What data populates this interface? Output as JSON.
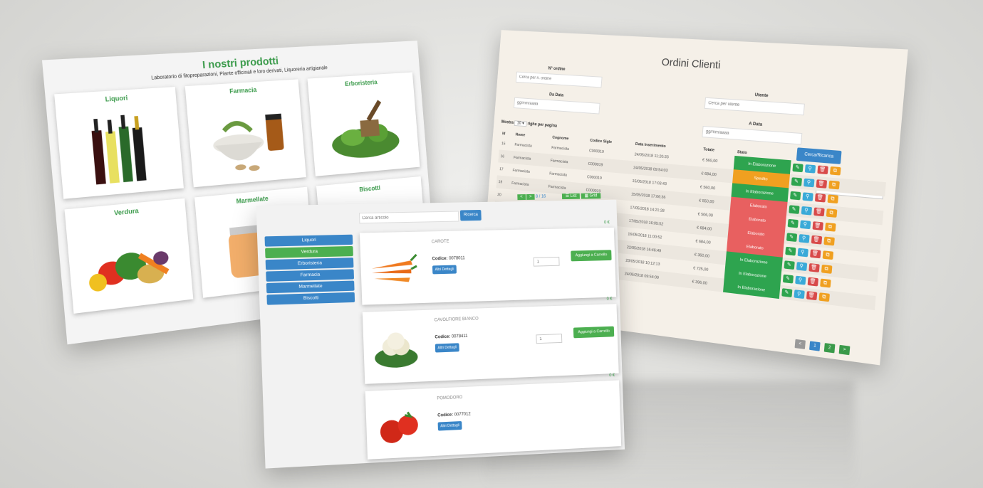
{
  "products": {
    "title": "I nostri prodotti",
    "subtitle": "Laboratorio di fitopreparazioni, Piante officinali e loro derivati, Liquoreria artigianale",
    "categories": [
      {
        "label": "Liquori"
      },
      {
        "label": "Farmacia"
      },
      {
        "label": "Erboristeria"
      },
      {
        "label": "Verdura"
      },
      {
        "label": "Marmellate"
      },
      {
        "label": "Biscotti"
      }
    ]
  },
  "orders": {
    "title": "Ordini Clienti",
    "filters": {
      "order_label": "N° ordine",
      "order_placeholder": "Cerca per n. ordine",
      "user_label": "Utente",
      "user_placeholder": "Cerca per utente",
      "from_label": "Da Data",
      "from_placeholder": "gg/mm/aaaa",
      "to_label": "A Data",
      "to_placeholder": "gg/mm/aaaa",
      "search_button": "Cerca/Ricarica"
    },
    "show_prefix": "Mostra",
    "show_value": "10",
    "show_suffix": "righe per pagina",
    "search_label": "Ricerca",
    "columns": [
      "Id",
      "Nome",
      "Cognome",
      "Codice Sigle",
      "Data Inserimento",
      "Totale",
      "Stato"
    ],
    "rows": [
      {
        "id": "15",
        "nome": "Farmacista",
        "cognome": "Farmacista",
        "codice": "C000019",
        "data": "24/05/2018 11:20:33",
        "totale": "€ 560,00",
        "stato": "In Elaborazione",
        "color": "#2ea44f"
      },
      {
        "id": "16",
        "nome": "Farmacista",
        "cognome": "Farmacista",
        "codice": "C000019",
        "data": "24/05/2018 09:54:03",
        "totale": "€ 684,00",
        "stato": "Spedito",
        "color": "#f0a020"
      },
      {
        "id": "17",
        "nome": "Farmacista",
        "cognome": "Farmacista",
        "codice": "C000019",
        "data": "15/05/2018 17:03:43",
        "totale": "€ 560,00",
        "stato": "In Elaborazione",
        "color": "#2ea44f"
      },
      {
        "id": "19",
        "nome": "Farmacista",
        "cognome": "Farmacista",
        "codice": "C000019",
        "data": "15/05/2018 17:06:36",
        "totale": "€ 550,00",
        "stato": "Elaborato",
        "color": "#e86060"
      },
      {
        "id": "20",
        "nome": "",
        "cognome": "",
        "codice": "",
        "data": "17/05/2018 14:21:28",
        "totale": "€ 506,00",
        "stato": "Elaborato",
        "color": "#e86060"
      },
      {
        "id": "",
        "nome": "",
        "cognome": "",
        "codice": "",
        "data": "17/05/2018 16:05:52",
        "totale": "€ 684,00",
        "stato": "Elaborato",
        "color": "#e86060"
      },
      {
        "id": "",
        "nome": "",
        "cognome": "",
        "codice": "",
        "data": "16/05/2018 11:00:52",
        "totale": "€ 684,00",
        "stato": "Elaborato",
        "color": "#e86060"
      },
      {
        "id": "",
        "nome": "",
        "cognome": "",
        "codice": "",
        "data": "22/05/2018 16:46:49",
        "totale": "€ 360,00",
        "stato": "In Elaborazione",
        "color": "#2ea44f"
      },
      {
        "id": "",
        "nome": "",
        "cognome": "",
        "codice": "",
        "data": "23/05/2018 10:12:13",
        "totale": "€ 725,00",
        "stato": "In Elaborazione",
        "color": "#2ea44f"
      },
      {
        "id": "",
        "nome": "",
        "cognome": "",
        "codice": "",
        "data": "24/05/2018 09:54:09",
        "totale": "€ 396,00",
        "stato": "In Elaborazione",
        "color": "#2ea44f"
      }
    ],
    "pagination": {
      "prev": "<",
      "pages": [
        "1",
        "2"
      ],
      "next": ">"
    }
  },
  "catalog": {
    "search_placeholder": "Cerca articolo",
    "search_button": "Ricerca",
    "pager_text": "8 / 16",
    "pager_prev": "<",
    "pager_next": ">",
    "list_button": "List",
    "grid_button": "Grid",
    "sidebar": [
      "Liquori",
      "Verdura",
      "Erboristeria",
      "Farmacia",
      "Marmellate",
      "Biscotti"
    ],
    "items": [
      {
        "name": "CAROTE",
        "code_label": "Codice:",
        "code": "0078011",
        "details": "Altri Dettagli",
        "qty": "1",
        "add": "Aggiungi a Carrello",
        "price": "0 €"
      },
      {
        "name": "CAVOLFIORE BIANCO",
        "code_label": "Codice:",
        "code": "0078411",
        "details": "Altri Dettagli",
        "qty": "1",
        "add": "Aggiungi a Carrello",
        "price": "0 €"
      },
      {
        "name": "POMODORO",
        "code_label": "Codice:",
        "code": "0077012",
        "details": "Altri Dettagli",
        "qty": "",
        "add": "",
        "price": "0 €"
      }
    ]
  },
  "colors": {
    "green": "#3a9a4a",
    "blue": "#3a86c8",
    "orange": "#f0a020",
    "red": "#e86060"
  }
}
